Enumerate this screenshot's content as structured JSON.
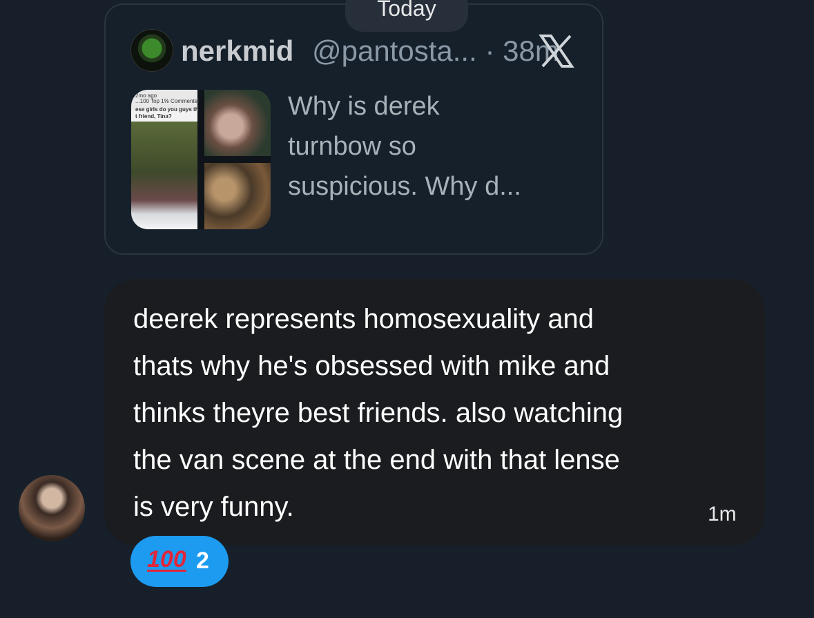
{
  "date_separator": "Today",
  "quoted_post": {
    "author_name": "nerkmid",
    "author_handle": "@pantosta... · 38m",
    "source_icon": "x-logo-icon",
    "media_caption_lines": [
      "2mo ago",
      "...100  Top 1% Commenter",
      "ese girls do you guys th",
      "t friend, Tina?"
    ],
    "text": "Why is derek\nturnbow so\nsuspicious. Why d..."
  },
  "message": {
    "text": "deerek represents homosexuality and\nthats why he's obsessed with mike and\nthinks theyre best friends. also watching\nthe van scene at the end with that lense\nis very funny.",
    "time": "1m"
  },
  "reaction": {
    "emoji": "💯",
    "count": "2",
    "color": "#1d9bf0"
  }
}
